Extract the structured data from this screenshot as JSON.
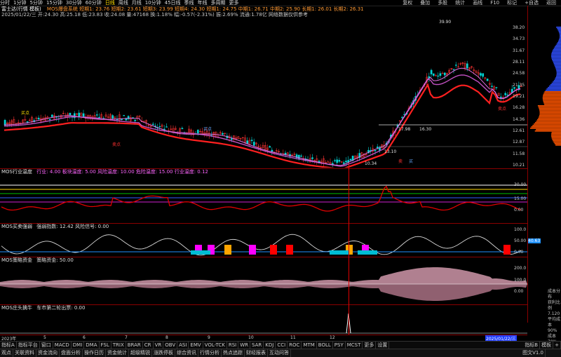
{
  "toolbar": {
    "items": [
      "分时",
      "1分钟",
      "5分钟",
      "15分钟",
      "30分钟",
      "60分钟",
      "日线",
      "周线",
      "月线",
      "10分钟",
      "45日线",
      "季线",
      "年线",
      "多周期",
      "更多"
    ],
    "selected": "日线",
    "right_buttons": [
      "复权",
      "叠加",
      "多股",
      "统计",
      "画线",
      "F10",
      "标记",
      "+自选",
      "返回"
    ]
  },
  "info": {
    "stock_name": "富士达(行情 模板)",
    "line1_values": "MOS爆盘系统 短期1: 23.76 短期2: 23.61 短期3: 23.99 短期4: 24.30 短期1: 24.75 中期1: 26.71 中期2: 25.90 长期1: 26.01 长期2: 26.31",
    "line2_values": "2025/01/22/三 开:24.30 高:25.18 低:23.83 收:24.08 量:47168 换:1.18% 幅:-0.57(-2.31%) 振:2.69% 流通:1.78亿 网络数据仅供参考"
  },
  "main_chart": {
    "y_ticks": [
      "38.20",
      "34.73",
      "31.67",
      "28.11",
      "24.58",
      "21.35",
      "19.21",
      "16.28",
      "14.36",
      "12.61",
      "12.87",
      "11.58",
      "10.21"
    ],
    "price_labels": {
      "high": "39.90",
      "box_top": "17.98",
      "box_top2": "16.30",
      "box_low": "13.10",
      "low": "10.34"
    },
    "annotations": [
      "买点",
      "卖点",
      "买点",
      "卖点",
      "卖",
      "买"
    ]
  },
  "sub1": {
    "title": "MOS行业温度",
    "values": "行业: 4.00 板块温度: 5.00 风险温度: 10.00 危险温度: 15.00 行业温度: 0.12",
    "y_ticks": [
      "30.00",
      "15.00",
      "0.00"
    ]
  },
  "sub2": {
    "title": "MOS买卖强弱",
    "values": "强弱指数: 12.42 风险信号: 0.00",
    "y_ticks": [
      "100.0",
      "50.00",
      "0.00"
    ],
    "current": "40.63"
  },
  "sub3": {
    "title": "MOS策略资金",
    "values": "策略资金: 50.00",
    "y_ticks": [
      "200.0",
      "100.0",
      "0.00"
    ]
  },
  "sub4": {
    "title": "MOS庄头擒牛",
    "values": "车市第二轮出票: 0.00"
  },
  "time_axis": {
    "labels": [
      "2023年",
      "5",
      "6",
      "7",
      "8",
      "9",
      "10",
      "11",
      "12",
      "2025/01/22/三"
    ]
  },
  "indicator_tabs": [
    "指标A",
    "指标平台",
    "窗口",
    "MACD",
    "DMI",
    "DMA",
    "FSL",
    "TRIX",
    "BRAR",
    "CR",
    "VR",
    "OBV",
    "ASI",
    "EMV",
    "VOL-TCK",
    "RSI",
    "WR",
    "SAR",
    "KDJ",
    "CCI",
    "ROC",
    "MTM",
    "BOLL",
    "PSY",
    "MCST",
    "更多",
    "设置"
  ],
  "indicator_right": [
    "指标B",
    "模板",
    "+"
  ],
  "bottom_tabs": [
    "观点",
    "关联资料",
    "资金流向",
    "盘面分析",
    "操作日历",
    "资金统计",
    "超级精锐",
    "涨跌停板",
    "综合资讯",
    "行情分析",
    "热点追踪",
    "财经报表",
    "互动问答"
  ],
  "bottom_right": "图文V1.0",
  "right_panel": {
    "labels": [
      "成本分布",
      "获利比例",
      "7.120",
      "平均成本"
    ],
    "values": [
      "90%成本",
      "70%成本"
    ]
  },
  "colors": {
    "bg": "#000000",
    "up": "#ff3333",
    "down": "#00d4d4",
    "ma_red": "#ff2020",
    "ma_purple": "#d060d0",
    "highlight": "#ffe000",
    "cost_orange": "#ff6600"
  }
}
